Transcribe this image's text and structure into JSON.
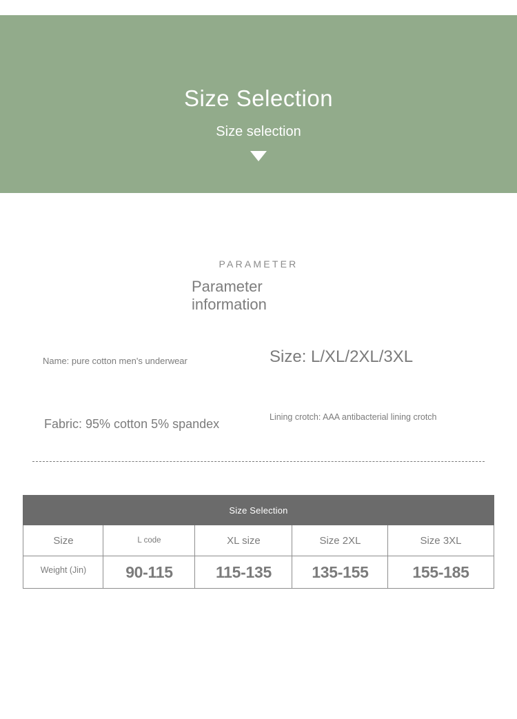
{
  "hero": {
    "title": "Size Selection",
    "subtitle": "Size selection",
    "arrow_icon": "triangle-down-icon",
    "background_color": "#92ab8b"
  },
  "parameter_section": {
    "eyebrow": "PARAMETER",
    "title": "Parameter information",
    "items": [
      {
        "key": "name",
        "text": "Name: pure cotton men's underwear"
      },
      {
        "key": "size",
        "text": "Size: L/XL/2XL/3XL"
      },
      {
        "key": "fabric",
        "text": "Fabric: 95% cotton 5% spandex"
      },
      {
        "key": "lining",
        "text": "Lining crotch: AAA antibacterial lining crotch"
      }
    ]
  },
  "divider": {
    "style": "dashed",
    "color": "#7a7a7a"
  },
  "size_table": {
    "caption": "Size Selection",
    "header_background": "#6b6b6b",
    "border_color": "#8d8d8d",
    "head_row": {
      "row_label": "Size",
      "columns": [
        "L code",
        "XL size",
        "Size 2XL",
        "Size 3XL"
      ]
    },
    "value_row": {
      "row_label": "Weight (Jin)",
      "values": [
        "90-115",
        "115-135",
        "135-155",
        "155-185"
      ]
    }
  }
}
